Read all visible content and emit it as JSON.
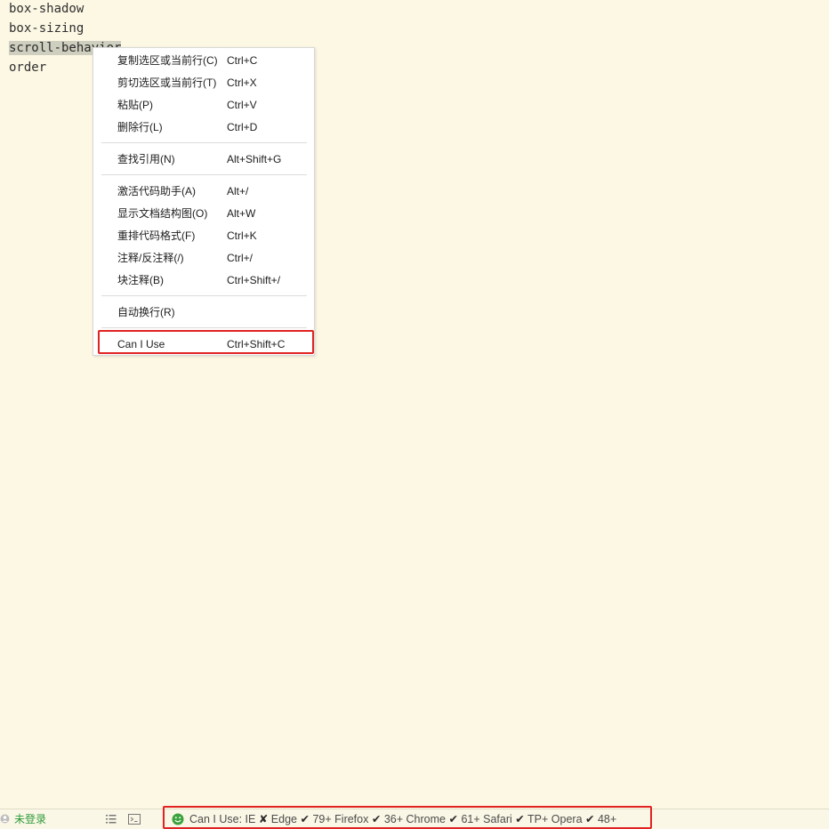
{
  "editor": {
    "lines": [
      {
        "text": "box-shadow",
        "selected": false
      },
      {
        "text": "box-sizing",
        "selected": false
      },
      {
        "text": "scroll-behavior",
        "selected": true
      },
      {
        "text": "order",
        "selected": false
      }
    ]
  },
  "context_menu": {
    "items": [
      {
        "label": "复制选区或当前行(C)",
        "shortcut": "Ctrl+C"
      },
      {
        "label": "剪切选区或当前行(T)",
        "shortcut": "Ctrl+X"
      },
      {
        "label": "粘贴(P)",
        "shortcut": "Ctrl+V"
      },
      {
        "label": "删除行(L)",
        "shortcut": "Ctrl+D"
      },
      {
        "label": "查找引用(N)",
        "shortcut": "Alt+Shift+G"
      },
      {
        "label": "激活代码助手(A)",
        "shortcut": "Alt+/"
      },
      {
        "label": "显示文档结构图(O)",
        "shortcut": "Alt+W"
      },
      {
        "label": "重排代码格式(F)",
        "shortcut": "Ctrl+K"
      },
      {
        "label": "注释/反注释(/)",
        "shortcut": "Ctrl+/"
      },
      {
        "label": "块注释(B)",
        "shortcut": "Ctrl+Shift+/"
      },
      {
        "label": "自动换行(R)",
        "shortcut": ""
      },
      {
        "label": "Can I Use",
        "shortcut": "Ctrl+Shift+C"
      }
    ]
  },
  "statusbar": {
    "login_status": "未登录",
    "caniuse": {
      "prefix": "Can I Use: ",
      "browsers": [
        {
          "name": "IE",
          "mark": "✘",
          "version": ""
        },
        {
          "name": "Edge",
          "mark": "✔",
          "version": "79+"
        },
        {
          "name": "Firefox",
          "mark": "✔",
          "version": "36+"
        },
        {
          "name": "Chrome",
          "mark": "✔",
          "version": "61+"
        },
        {
          "name": "Safari",
          "mark": "✔",
          "version": "TP+"
        },
        {
          "name": "Opera",
          "mark": "✔",
          "version": "48+"
        }
      ]
    }
  },
  "colors": {
    "editor_background": "#fdf8e4",
    "highlight_border": "#e12222",
    "login_text": "#2e9b3a",
    "selection": "#cfcfc0"
  },
  "icons": {
    "user": "user-icon",
    "outline": "outline-icon",
    "terminal": "terminal-icon",
    "status": "smile-icon"
  }
}
